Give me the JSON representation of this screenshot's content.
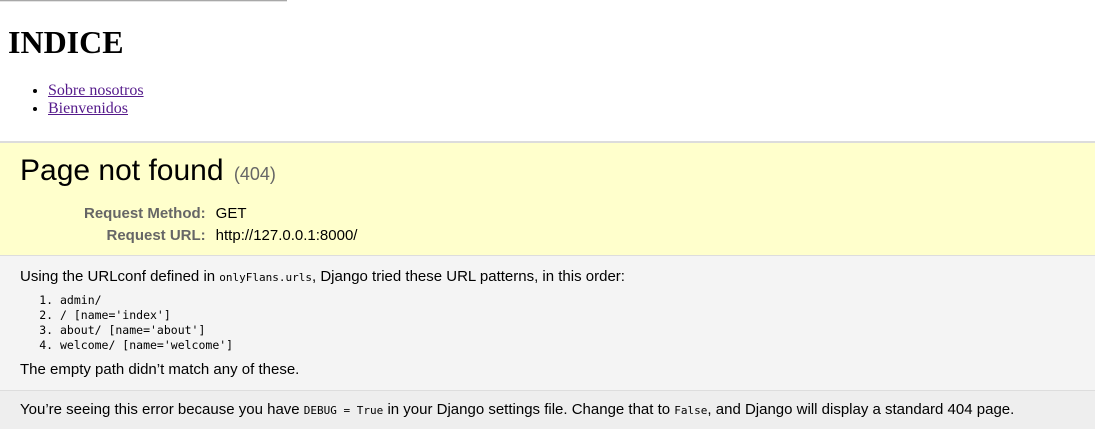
{
  "site": {
    "title": "INDICE",
    "nav": [
      {
        "label": "Sobre nosotros"
      },
      {
        "label": "Bienvenidos"
      }
    ]
  },
  "error": {
    "title": "Page not found",
    "code": "(404)",
    "request_method_label": "Request Method:",
    "request_method": "GET",
    "request_url_label": "Request URL:",
    "request_url": "http://127.0.0.1:8000/"
  },
  "info": {
    "intro_before": "Using the URLconf defined in ",
    "urlconf": "onlyFlans.urls",
    "intro_after": ", Django tried these URL patterns, in this order:",
    "patterns": [
      "admin/",
      "/ [name='index']",
      "about/ [name='about']",
      "welcome/ [name='welcome']"
    ],
    "no_match": "The empty path didn’t match any of these."
  },
  "explanation": {
    "part1": "You’re seeing this error because you have ",
    "debug_code": "DEBUG = True",
    "part2": " in your Django settings file. Change that to ",
    "false_code": "False",
    "part3": ", and Django will display a standard 404 page."
  },
  "colors": {
    "summary_bg": "#ffffcc",
    "info_bg": "#f4f4f4",
    "explanation_bg": "#eeeeee",
    "visited_link": "#551a8b"
  }
}
